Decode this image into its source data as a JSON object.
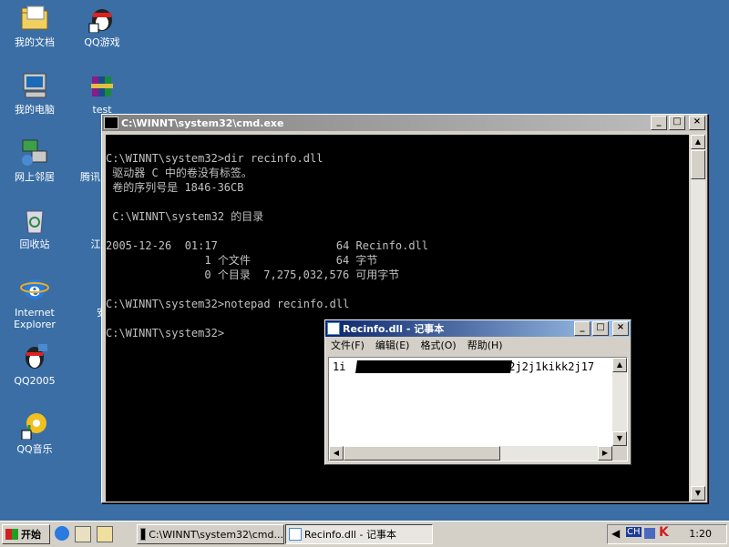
{
  "desktop": {
    "icons": [
      {
        "label": "我的文档",
        "icon": "my-documents-icon"
      },
      {
        "label": "QQ游戏",
        "icon": "qq-game-icon"
      },
      {
        "label": "我的电脑",
        "icon": "my-computer-icon"
      },
      {
        "label": "test",
        "icon": "winrar-icon"
      },
      {
        "label": "网上邻居",
        "icon": "network-icon"
      },
      {
        "label": "腾讯",
        "icon": "tencent-icon"
      },
      {
        "label": "回收站",
        "icon": "recycle-bin-icon"
      },
      {
        "label": "江民杀",
        "icon": "jiangmin-icon"
      },
      {
        "label": "Internet Explorer",
        "icon": "ie-icon"
      },
      {
        "label": "安全",
        "icon": "kv-security-icon"
      },
      {
        "label": "QQ2005",
        "icon": "qq-icon"
      },
      {
        "label": "QQ音乐",
        "icon": "qq-music-icon"
      }
    ]
  },
  "cmd": {
    "title": "C:\\WINNT\\system32\\cmd.exe",
    "lines": [
      "C:\\WINNT\\system32>dir recinfo.dll",
      " 驱动器 C 中的卷没有标签。",
      " 卷的序列号是 1846-36CB",
      "",
      " C:\\WINNT\\system32 的目录",
      "",
      "2005-12-26  01:17                  64 Recinfo.dll",
      "               1 个文件             64 字节",
      "               0 个目录  7,275,032,576 可用字节",
      "",
      "C:\\WINNT\\system32>notepad recinfo.dll",
      "",
      "C:\\WINNT\\system32>"
    ]
  },
  "notepad": {
    "title": "Recinfo.dll - 记事本",
    "menu": [
      "文件(F)",
      "编辑(E)",
      "格式(O)",
      "帮助(H)"
    ],
    "content_visible": "1i",
    "content_tail": "i2j2j1kikk2j17"
  },
  "taskbar": {
    "start_label": "开始",
    "tasks": [
      "C:\\WINNT\\system32\\cmd...",
      "Recinfo.dll - 记事本"
    ],
    "clock": "1:20",
    "tray_ime": "CH"
  },
  "colors": {
    "desktop": "#3a6ea5",
    "title_active": "#0a246a",
    "title_inactive": "#808080"
  }
}
